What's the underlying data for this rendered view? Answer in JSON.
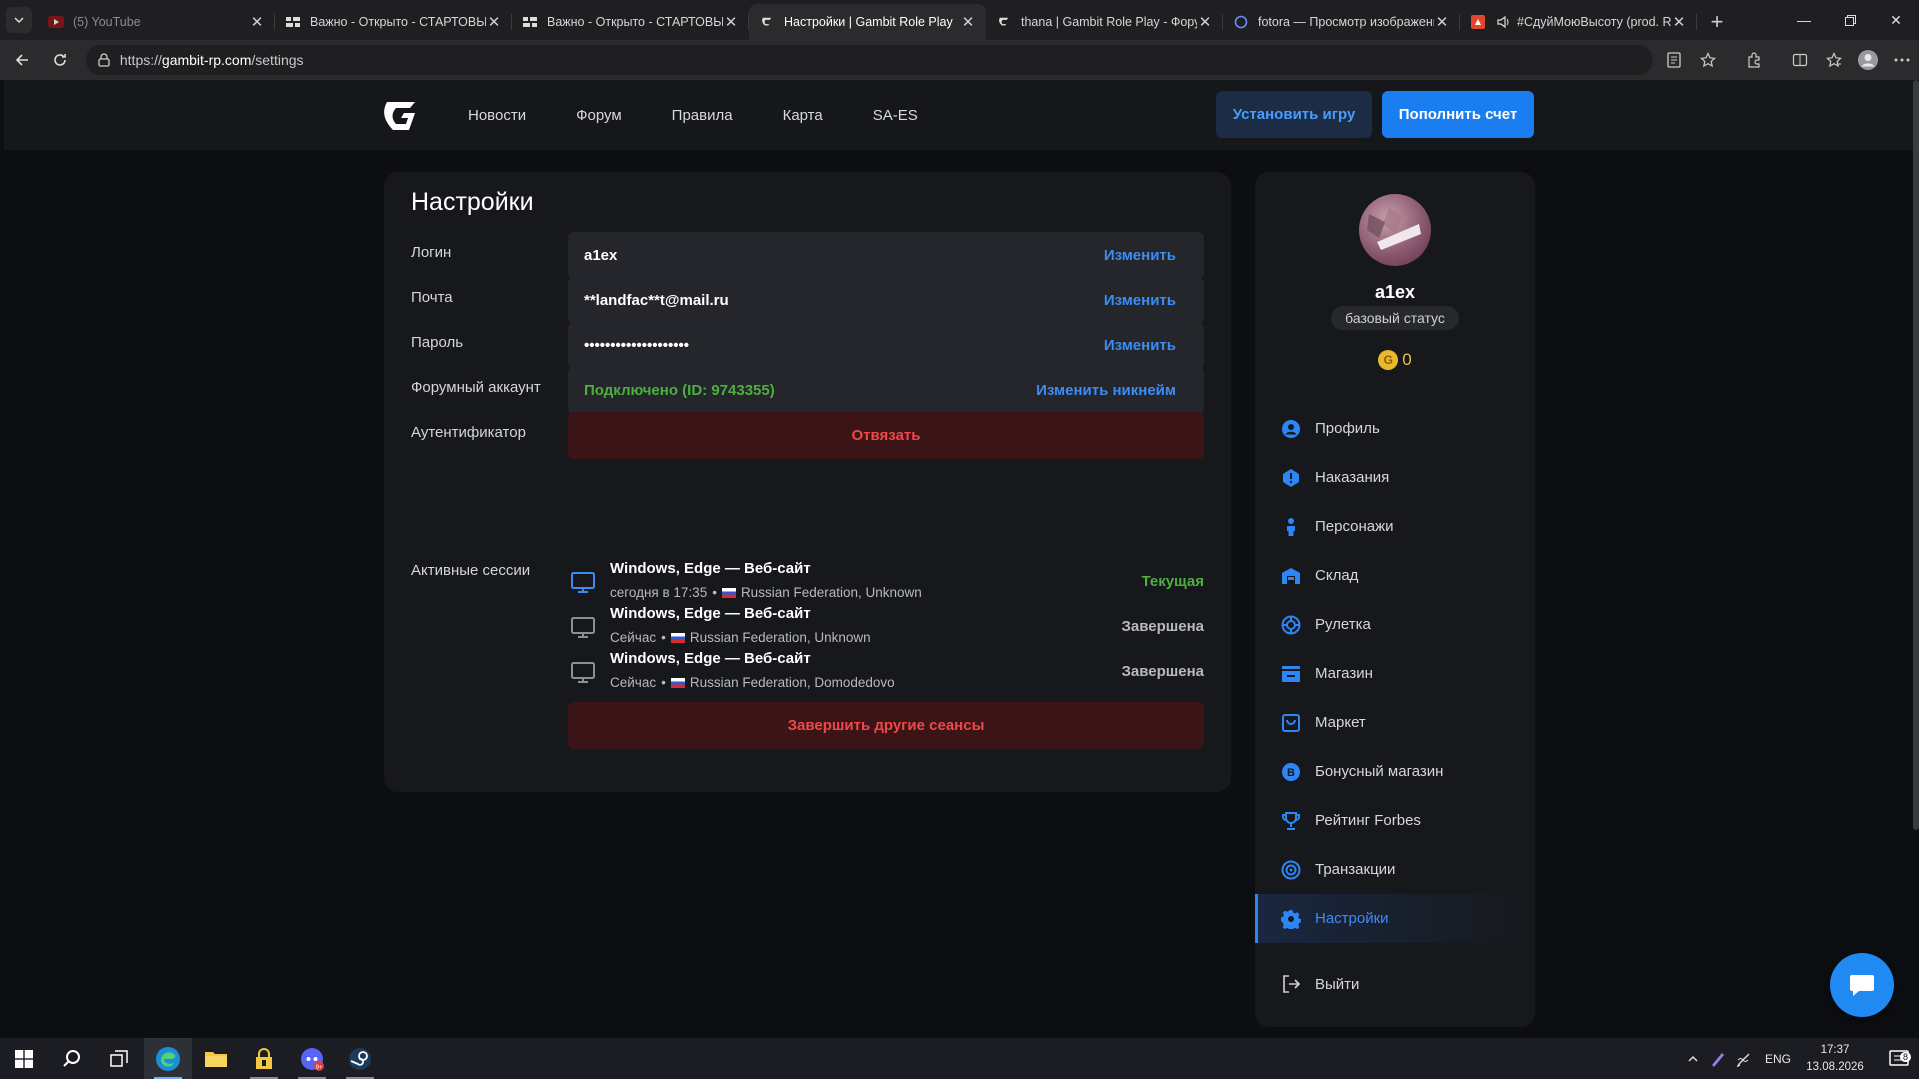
{
  "browser": {
    "tabs": [
      {
        "title": "(5) YouTube",
        "icon": "youtube-icon",
        "active": false,
        "dim": true
      },
      {
        "title": "Важно - Открыто - СТАРТОВЫЙ С",
        "icon": "forum-icon",
        "active": false
      },
      {
        "title": "Важно - Открыто - СТАРТОВЫЙ С",
        "icon": "forum-icon",
        "active": false
      },
      {
        "title": "Настройки | Gambit Role Play",
        "icon": "gambit-icon",
        "active": true
      },
      {
        "title": "thana | Gambit Role Play - Форум",
        "icon": "gambit-icon",
        "active": false
      },
      {
        "title": "fotora — Просмотр изображени",
        "icon": "circle-icon",
        "active": false
      },
      {
        "title": "#СдуйМоюВысоту (prod. Ro",
        "icon": "music-icon",
        "active": false
      }
    ],
    "url_scheme": "https://",
    "url_host": "gambit-rp.com",
    "url_path": "/settings"
  },
  "header": {
    "nav": [
      "Новости",
      "Форум",
      "Правила",
      "Карта",
      "SA-ES"
    ],
    "install_label": "Установить игру",
    "topup_label": "Пополнить счет"
  },
  "settings": {
    "title": "Настройки",
    "rows": [
      {
        "label": "Логин",
        "value": "a1ex",
        "action": "Изменить"
      },
      {
        "label": "Почта",
        "value": "**landfac**t@mail.ru",
        "action": "Изменить"
      },
      {
        "label": "Пароль",
        "value": "••••••••••••••••••••",
        "action": "Изменить"
      },
      {
        "label": "Форумный аккаунт",
        "value": "Подключено (ID: 9743355)",
        "action": "Изменить никнейм"
      },
      {
        "label": "Аутентификатор",
        "value": "Отвязать"
      }
    ],
    "sessions_label": "Активные сессии",
    "sessions": [
      {
        "title": "Windows, Edge — Веб-сайт",
        "time": "сегодня в 17:35",
        "location": "Russian Federation, Unknown",
        "status": "Текущая",
        "current": true
      },
      {
        "title": "Windows, Edge — Веб-сайт",
        "time": "Сейчас",
        "location": "Russian Federation, Unknown",
        "status": "Завершена",
        "current": false
      },
      {
        "title": "Windows, Edge — Веб-сайт",
        "time": "Сейчас",
        "location": "Russian Federation, Domodedovo",
        "status": "Завершена",
        "current": false
      }
    ],
    "end_sessions_label": "Завершить другие сеансы"
  },
  "profile": {
    "username": "a1ex",
    "status": "базовый статус",
    "coins": "0",
    "menu": [
      {
        "label": "Профиль",
        "icon": "user-icon"
      },
      {
        "label": "Наказания",
        "icon": "warning-icon"
      },
      {
        "label": "Персонажи",
        "icon": "person-icon"
      },
      {
        "label": "Склад",
        "icon": "warehouse-icon"
      },
      {
        "label": "Рулетка",
        "icon": "roulette-icon"
      },
      {
        "label": "Магазин",
        "icon": "shop-icon"
      },
      {
        "label": "Маркет",
        "icon": "bag-icon"
      },
      {
        "label": "Бонусный магазин",
        "icon": "bonus-icon"
      },
      {
        "label": "Рейтинг Forbes",
        "icon": "trophy-icon"
      },
      {
        "label": "Транзакции",
        "icon": "transactions-icon"
      },
      {
        "label": "Настройки",
        "icon": "gear-icon",
        "active": true
      }
    ],
    "logout_label": "Выйти"
  },
  "taskbar": {
    "lang": "ENG",
    "time": "17:37",
    "date": "13.08.2026",
    "notifications": "8"
  },
  "colors": {
    "accent": "#2d86f5",
    "success": "#4caf3f",
    "danger": "#f04848",
    "card_bg": "#17181c",
    "page_bg": "#0d0e12"
  }
}
